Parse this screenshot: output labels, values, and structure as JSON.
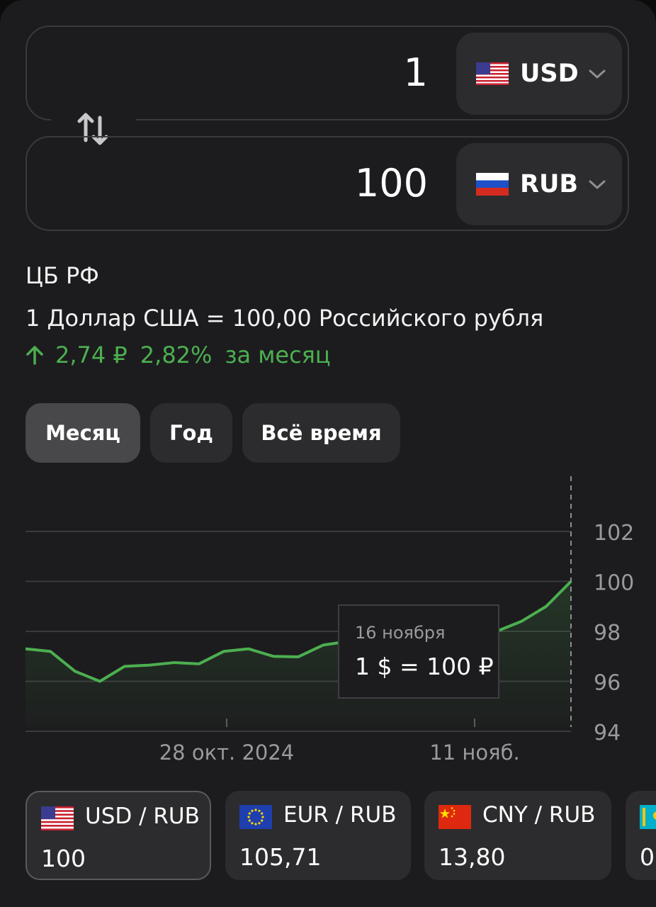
{
  "converter": {
    "from": {
      "amount": "1",
      "code": "USD",
      "flag_icon": "us-flag-icon"
    },
    "to": {
      "amount": "100",
      "code": "RUB",
      "flag_icon": "ru-flag-icon"
    }
  },
  "source": "ЦБ РФ",
  "rate_text": "1 Доллар США = 100,00 Российского рубля",
  "change": {
    "direction": "up",
    "absolute": "2,74 ₽",
    "percent": "2,82%",
    "period": "за месяц",
    "color": "#4caf50"
  },
  "periods": [
    {
      "label": "Месяц",
      "active": true
    },
    {
      "label": "Год",
      "active": false
    },
    {
      "label": "Всё время",
      "active": false
    }
  ],
  "chart_data": {
    "type": "area",
    "ylim": [
      94,
      102
    ],
    "yticks": [
      "102",
      "100",
      "98",
      "96",
      "94"
    ],
    "xticks": [
      {
        "label": "28 окт. 2024",
        "index": 8
      },
      {
        "label": "11 нояб.",
        "index": 18
      }
    ],
    "series": [
      {
        "values": [
          97.3,
          97.2,
          96.4,
          96.0,
          96.6,
          96.65,
          96.75,
          96.7,
          97.2,
          97.3,
          97.0,
          96.98,
          97.45,
          97.6,
          97.7,
          97.75,
          97.8,
          97.9,
          97.95,
          98.0,
          98.4,
          99.0,
          100.0
        ]
      }
    ],
    "line_color": "#4caf50",
    "grid": true
  },
  "tooltip": {
    "date": "16 ноября",
    "value": "1 $ = 100 ₽"
  },
  "tiles": [
    {
      "pair": "USD / RUB",
      "value": "100",
      "flag_icon": "us-flag-icon",
      "active": true
    },
    {
      "pair": "EUR / RUB",
      "value": "105,71",
      "flag_icon": "eu-flag-icon",
      "active": false
    },
    {
      "pair": "CNY / RUB",
      "value": "13,80",
      "flag_icon": "cn-flag-icon",
      "active": false
    },
    {
      "pair": "",
      "value": "0",
      "flag_icon": "kz-flag-icon",
      "active": false
    }
  ]
}
